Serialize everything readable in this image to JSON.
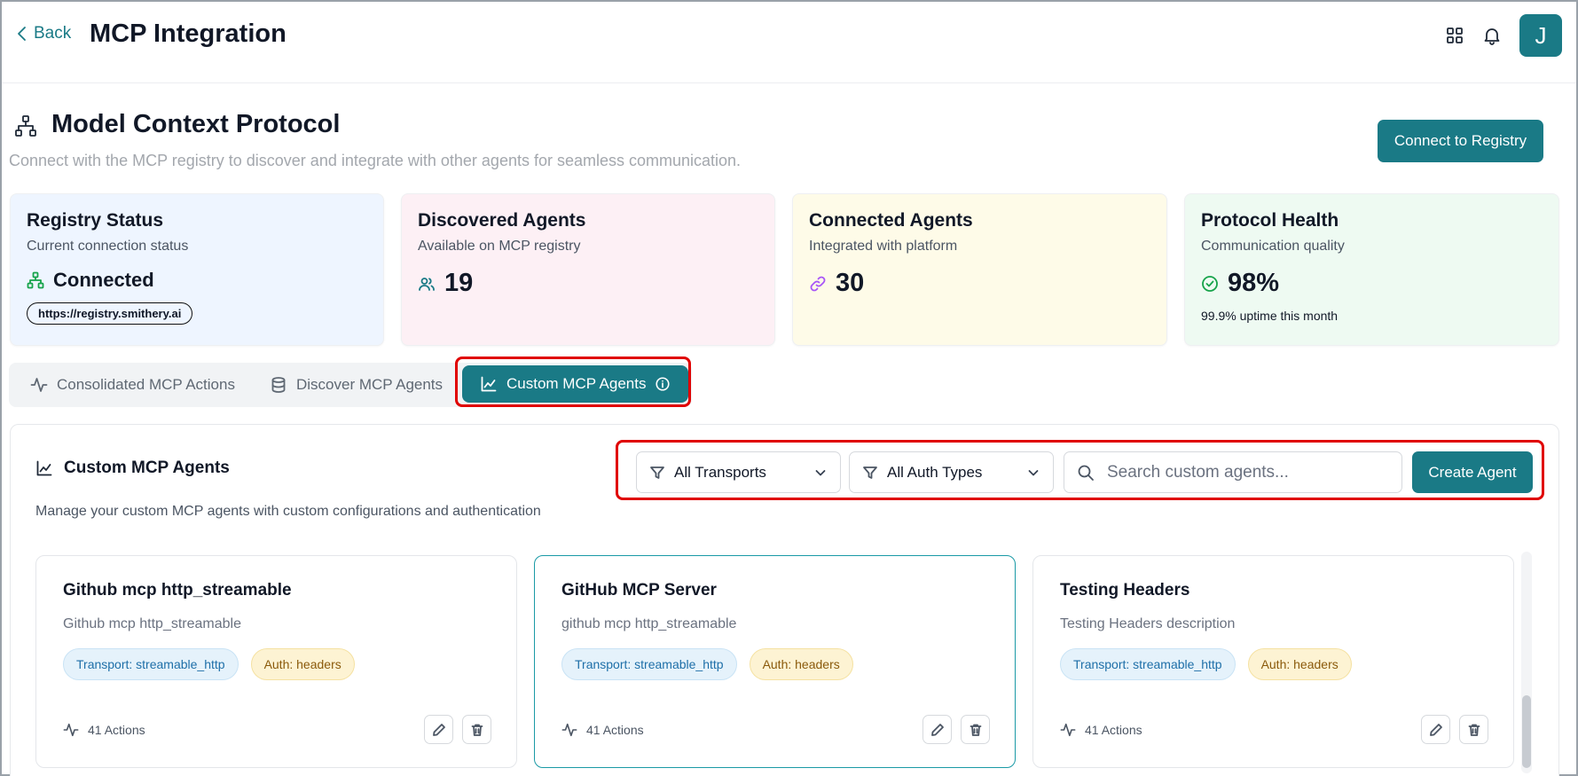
{
  "header": {
    "back_label": "Back",
    "title": "MCP Integration",
    "avatar_initial": "J",
    "icons": [
      "grid-icon",
      "bell-icon"
    ]
  },
  "section": {
    "title": "Model Context Protocol",
    "description": "Connect with the MCP registry to discover and integrate with other agents for seamless communication.",
    "connect_button": "Connect to Registry"
  },
  "stats": [
    {
      "title": "Registry Status",
      "subtitle": "Current connection status",
      "value": "Connected",
      "extra": "https://registry.smithery.ai",
      "bg": "#eef5ff",
      "icon": "network-icon",
      "icon_color": "#16a34a"
    },
    {
      "title": "Discovered Agents",
      "subtitle": "Available on MCP registry",
      "value": "19",
      "bg": "#fdf0f5",
      "icon": "users-icon",
      "icon_color": "#1a7a86"
    },
    {
      "title": "Connected Agents",
      "subtitle": "Integrated with platform",
      "value": "30",
      "bg": "#fefbe8",
      "icon": "link-icon",
      "icon_color": "#a855f7"
    },
    {
      "title": "Protocol Health",
      "subtitle": "Communication quality",
      "value": "98%",
      "extra": "99.9% uptime this month",
      "bg": "#eefaf2",
      "icon": "check-circle-icon",
      "icon_color": "#16a34a"
    }
  ],
  "tabs": [
    {
      "label": "Consolidated MCP Actions",
      "icon": "activity-icon"
    },
    {
      "label": "Discover MCP Agents",
      "icon": "database-icon"
    },
    {
      "label": "Custom MCP Agents",
      "icon": "chart-line-icon",
      "active": true
    }
  ],
  "panel": {
    "title": "Custom MCP Agents",
    "description": "Manage your custom MCP agents with custom configurations and authentication",
    "transport_filter": "All Transports",
    "auth_filter": "All Auth Types",
    "search_placeholder": "Search custom agents...",
    "create_button": "Create Agent"
  },
  "agents": [
    {
      "name": "Github mcp http_streamable",
      "description": "Github mcp http_streamable",
      "transport": "Transport: streamable_http",
      "auth": "Auth: headers",
      "actions": "41 Actions"
    },
    {
      "name": "GitHub MCP Server",
      "description": "github mcp http_streamable",
      "transport": "Transport: streamable_http",
      "auth": "Auth: headers",
      "actions": "41 Actions",
      "selected": true
    },
    {
      "name": "Testing Headers",
      "description": "Testing Headers description",
      "transport": "Transport: streamable_http",
      "auth": "Auth: headers",
      "actions": "41 Actions"
    }
  ],
  "colors": {
    "accent": "#1a7a86",
    "highlight": "#e00000"
  }
}
